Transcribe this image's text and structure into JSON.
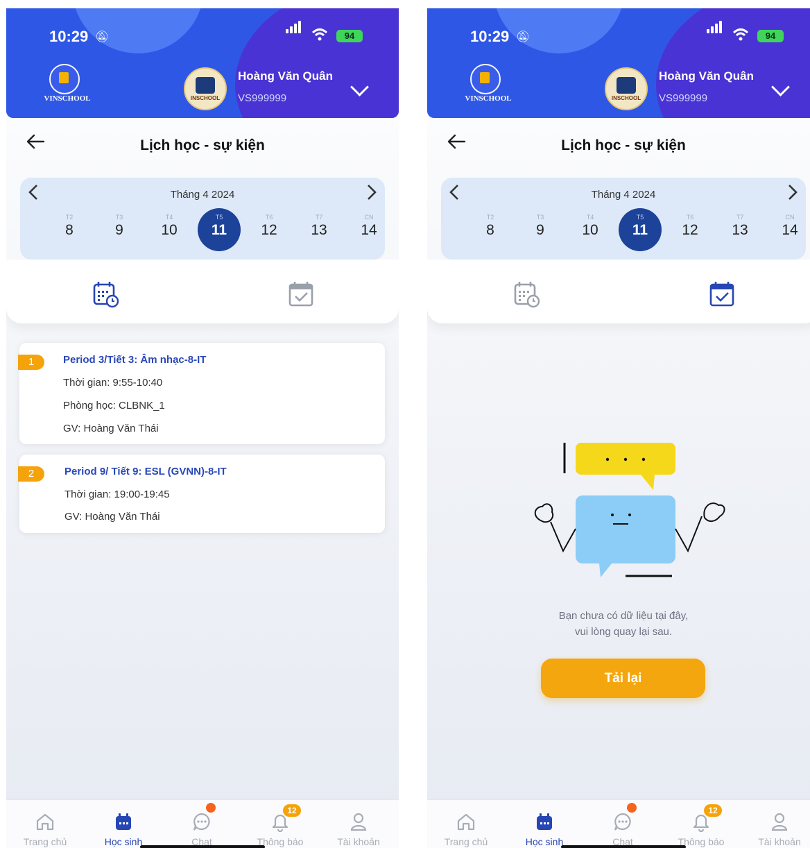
{
  "status": {
    "time": "10:29",
    "battery": "94"
  },
  "header": {
    "school_logo_text": "VINSCHOOL",
    "avatar_text": "INSCHOOL",
    "student_name": "Hoàng Văn Quân",
    "student_id": "VS999999"
  },
  "page": {
    "title": "Lịch học - sự kiện"
  },
  "calendar": {
    "month_label": "Tháng 4 2024",
    "days": [
      {
        "weekday": "T2",
        "date": "8"
      },
      {
        "weekday": "T3",
        "date": "9"
      },
      {
        "weekday": "T4",
        "date": "10"
      },
      {
        "weekday": "T5",
        "date": "11",
        "selected": true
      },
      {
        "weekday": "T6",
        "date": "12"
      },
      {
        "weekday": "T7",
        "date": "13"
      },
      {
        "weekday": "CN",
        "date": "14"
      }
    ]
  },
  "tabs": [
    {
      "icon": "calendar-schedule-icon"
    },
    {
      "icon": "calendar-check-icon"
    }
  ],
  "left_tab_active": 0,
  "right_tab_active": 1,
  "schedule": [
    {
      "index": "1",
      "title": "Period 3/Tiết 3: Âm nhạc-8-IT",
      "time": "Thời gian: 9:55-10:40",
      "room": "Phòng học: CLBNK_1",
      "teacher": "GV: Hoàng Văn Thái"
    },
    {
      "index": "2",
      "title": "Period 9/ Tiết 9: ESL (GVNN)-8-IT",
      "time": "Thời gian: 19:00-19:45",
      "teacher": "GV: Hoàng Văn Thái"
    }
  ],
  "empty_state": {
    "line1": "Bạn chưa có dữ liệu tại đây,",
    "line2": "vui lòng quay lại sau.",
    "reload_label": "Tải lại"
  },
  "bottom_nav": [
    {
      "label": "Trang chủ",
      "icon": "home-icon"
    },
    {
      "label": "Học sinh",
      "icon": "student-calendar-icon",
      "active": true
    },
    {
      "label": "Chat",
      "icon": "chat-icon"
    },
    {
      "label": "Thông báo",
      "icon": "bell-icon",
      "badge": "12"
    },
    {
      "label": "Tài khoản",
      "icon": "account-icon"
    }
  ],
  "colors": {
    "header_blue": "#2f57e6",
    "selected_day": "#1c4299",
    "accent_orange": "#f5a30a",
    "active_nav": "#2646b4"
  }
}
